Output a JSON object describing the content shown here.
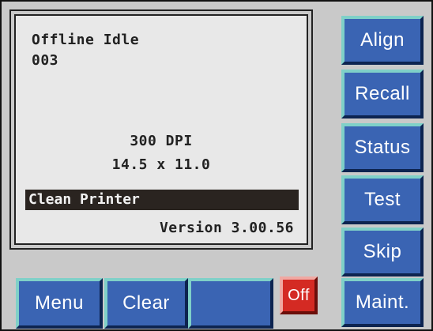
{
  "display": {
    "status": "Offline Idle",
    "job_number": "003",
    "resolution": "300 DPI",
    "media_size": "14.5 x 11.0",
    "message": "Clean Printer",
    "version": "Version 3.00.56"
  },
  "side_buttons": {
    "align": "Align",
    "recall": "Recall",
    "status": "Status",
    "test": "Test",
    "skip": "Skip",
    "maint": "Maint."
  },
  "bottom_buttons": {
    "menu": "Menu",
    "clear": "Clear",
    "blank": "",
    "off": "Off"
  },
  "colors": {
    "button_blue": "#3a64b3",
    "button_highlight": "#7fd0c8",
    "off_red": "#d42a23",
    "panel_gray": "#c9c9c9",
    "lcd_background": "#e8e8e8",
    "message_bar": "#2a2420"
  }
}
